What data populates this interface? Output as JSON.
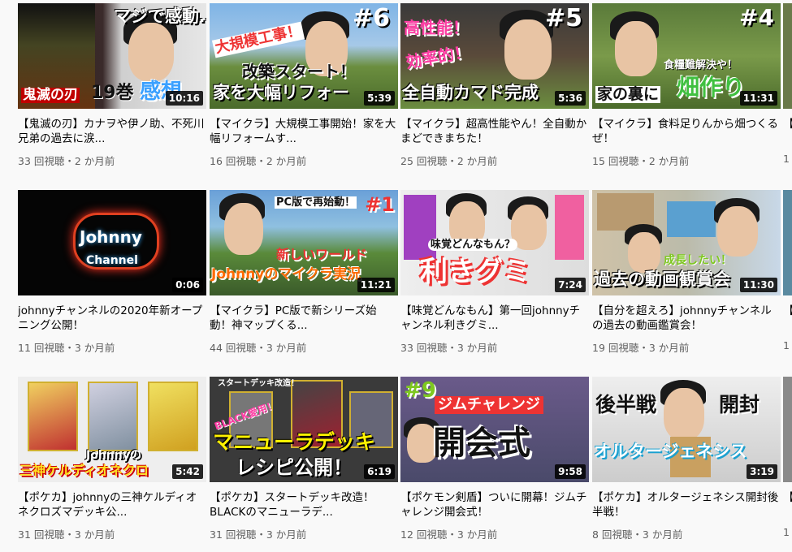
{
  "videos": [
    {
      "title": "【鬼滅の刃】カナヲや伊ノ助、不死川兄弟の過去に涙...",
      "meta": "33 回視聴・2 か月前",
      "duration": "10:16",
      "overlay_main": "19巻",
      "overlay_accent": "感想",
      "overlay_top": "マジで感動…",
      "overlay_red": "鬼滅の刃"
    },
    {
      "title": "【マイクラ】大規模工事開始！家を大幅リフォームす...",
      "meta": "16 回視聴・2 か月前",
      "duration": "5:39",
      "overlay_main": "改築スタート！",
      "overlay_accent": "家を大幅リフォー",
      "overlay_top": "大規模工事！",
      "overlay_num": "#6"
    },
    {
      "title": "【マイクラ】超高性能やん！全自動かまどできまちた！",
      "meta": "25 回視聴・2 か月前",
      "duration": "5:36",
      "overlay_main": "全自動カマド完成",
      "overlay_top": "高性能！",
      "overlay_accent": "効率的！",
      "overlay_num": "#5"
    },
    {
      "title": "【マイクラ】食料足りんから畑つくるぜ！",
      "meta": "15 回視聴・2 か月前",
      "duration": "11:31",
      "overlay_main": "家の裏に",
      "overlay_accent": "畑作り",
      "overlay_top": "食糧難解決や！",
      "overlay_num": "#4"
    },
    {
      "title": "johnnyチャンネルの2020年新オープニング公開！",
      "meta": "11 回視聴・3 か月前",
      "duration": "0:06",
      "overlay_main": "Johnny",
      "overlay_accent": "Channel"
    },
    {
      "title": "【マイクラ】PC版で新シリーズ始動！神マップくる...",
      "meta": "44 回視聴・3 か月前",
      "duration": "11:21",
      "overlay_main": "Johnnyのマイクラ実況",
      "overlay_accent": "新しいワールド",
      "overlay_top": "PC版で再始動！",
      "overlay_num": "#1"
    },
    {
      "title": "【味覚どんなもん】第一回johnnyチャンネル利きグミ...",
      "meta": "33 回視聴・3 か月前",
      "duration": "7:24",
      "overlay_main": "利きグミ",
      "overlay_top": "味覚どんなもん？"
    },
    {
      "title": "【自分を超えろ】johnnyチャンネルの過去の動画鑑賞会！",
      "meta": "19 回視聴・3 か月前",
      "duration": "11:30",
      "overlay_main": "過去の動画観賞会",
      "overlay_accent": "成長したい！"
    },
    {
      "title": "【ポケカ】johnnyの三神ケルディオネクロズマデッキ公...",
      "meta": "31 回視聴・3 か月前",
      "duration": "5:42",
      "overlay_main": "三神ケルディオネクロ",
      "overlay_top": "Johnnyの"
    },
    {
      "title": "【ポケカ】スタートデッキ改造！BLACKのマニューラデ...",
      "meta": "31 回視聴・3 か月前",
      "duration": "6:19",
      "overlay_main": "マニューラデッキ",
      "overlay_accent": "レシピ公開！",
      "overlay_top": "BLACK愛用！",
      "overlay_small": "スタートデッキ改造！"
    },
    {
      "title": "【ポケモン剣盾】ついに開幕！ジムチャレンジ開会式！",
      "meta": "12 回視聴・3 か月前",
      "duration": "9:58",
      "overlay_main": "開会式",
      "overlay_accent": "ジムチャレンジ",
      "overlay_num": "#9"
    },
    {
      "title": "【ポケカ】オルタージェネシス開封後半戦！",
      "meta": "8 回視聴・3 か月前",
      "duration": "3:19",
      "overlay_main": "オルタージェネシス",
      "overlay_top": "後半戦",
      "overlay_accent": "開封"
    }
  ],
  "partial_column": [
    {
      "title": "【宝",
      "meta": "1"
    },
    {
      "title": "【仲",
      "meta": "1"
    },
    {
      "title": "【",
      "meta": "1"
    }
  ]
}
